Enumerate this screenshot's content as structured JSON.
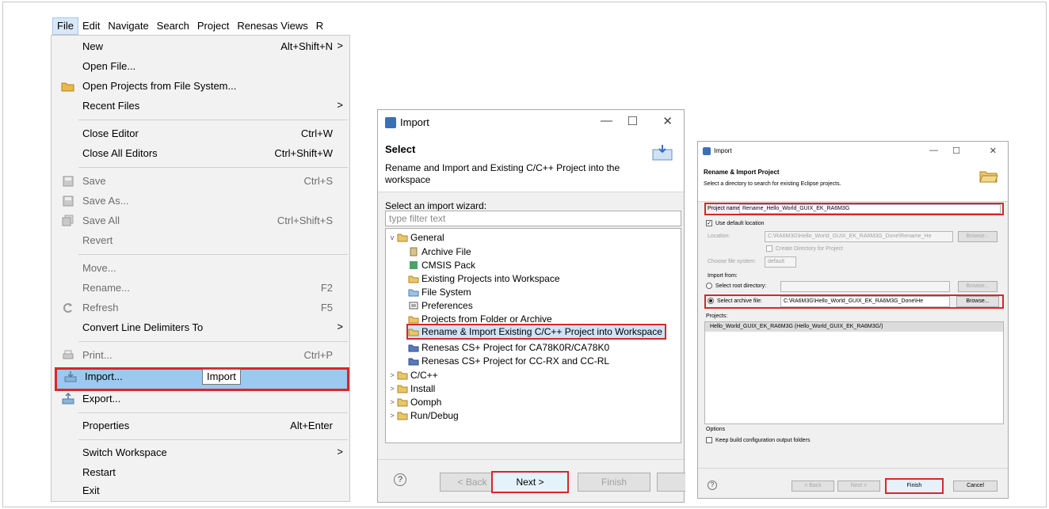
{
  "menubar": {
    "items": [
      "File",
      "Edit",
      "Navigate",
      "Search",
      "Project",
      "Renesas Views",
      "R"
    ]
  },
  "file_menu": {
    "items": [
      {
        "label": "New",
        "accel": "Alt+Shift+N",
        "submenu": true,
        "disabled": false
      },
      {
        "label": "Open File...",
        "accel": "",
        "disabled": false
      },
      {
        "label": "Open Projects from File System...",
        "accel": "",
        "disabled": false,
        "icon": "folder-open-icon"
      },
      {
        "label": "Recent Files",
        "accel": "",
        "submenu": true,
        "disabled": false
      },
      {
        "label": "Close Editor",
        "accel": "Ctrl+W",
        "disabled": false
      },
      {
        "label": "Close All Editors",
        "accel": "Ctrl+Shift+W",
        "disabled": false
      },
      {
        "label": "Save",
        "accel": "Ctrl+S",
        "disabled": true,
        "icon": "save-icon"
      },
      {
        "label": "Save As...",
        "accel": "",
        "disabled": true,
        "icon": "save-as-icon"
      },
      {
        "label": "Save All",
        "accel": "Ctrl+Shift+S",
        "disabled": true,
        "icon": "save-all-icon"
      },
      {
        "label": "Revert",
        "accel": "",
        "disabled": true
      },
      {
        "label": "Move...",
        "accel": "",
        "disabled": true
      },
      {
        "label": "Rename...",
        "accel": "F2",
        "disabled": true
      },
      {
        "label": "Refresh",
        "accel": "F5",
        "disabled": true,
        "icon": "refresh-icon"
      },
      {
        "label": "Convert Line Delimiters To",
        "accel": "",
        "submenu": true,
        "disabled": false
      },
      {
        "label": "Print...",
        "accel": "Ctrl+P",
        "disabled": true,
        "icon": "print-icon"
      },
      {
        "label": "Import...",
        "accel": "",
        "disabled": false,
        "icon": "import-icon",
        "selected": true
      },
      {
        "label": "Export...",
        "accel": "",
        "disabled": false,
        "icon": "export-icon"
      },
      {
        "label": "Properties",
        "accel": "Alt+Enter",
        "disabled": false
      },
      {
        "label": "Switch Workspace",
        "accel": "",
        "submenu": true,
        "disabled": false
      },
      {
        "label": "Restart",
        "accel": "",
        "disabled": false
      },
      {
        "label": "Exit",
        "accel": "",
        "disabled": false
      }
    ],
    "submenu_arrow": ">",
    "tooltip": "Import"
  },
  "import_dialog": {
    "title": "Import",
    "banner_title": "Select",
    "banner_desc": "Rename and Import and Existing C/C++ Project into the workspace",
    "wizard_label": "Select an import wizard:",
    "filter_placeholder": "type filter text",
    "tree": [
      {
        "label": "General",
        "twisty": "v",
        "level": 0,
        "icon": "folder-icon"
      },
      {
        "label": "Archive File",
        "level": 1,
        "icon": "archive-icon"
      },
      {
        "label": "CMSIS Pack",
        "level": 1,
        "icon": "cmsis-icon"
      },
      {
        "label": "Existing Projects into Workspace",
        "level": 1,
        "icon": "project-icon"
      },
      {
        "label": "File System",
        "level": 1,
        "icon": "filesystem-icon"
      },
      {
        "label": "Preferences",
        "level": 1,
        "icon": "preferences-icon"
      },
      {
        "label": "Projects from Folder or Archive",
        "level": 1,
        "icon": "folder-icon"
      },
      {
        "label": "Rename & Import Existing C/C++ Project into Workspace",
        "level": 1,
        "icon": "rename-import-icon",
        "selected": true
      },
      {
        "label": "Renesas CS+ Project for CA78K0R/CA78K0",
        "level": 1,
        "icon": "renesas-icon"
      },
      {
        "label": "Renesas CS+ Project for CC-RX and CC-RL",
        "level": 1,
        "icon": "renesas-icon"
      },
      {
        "label": "C/C++",
        "twisty": ">",
        "level": 0,
        "icon": "folder-icon"
      },
      {
        "label": "Install",
        "twisty": ">",
        "level": 0,
        "icon": "folder-icon"
      },
      {
        "label": "Oomph",
        "twisty": ">",
        "level": 0,
        "icon": "folder-icon"
      },
      {
        "label": "Run/Debug",
        "twisty": ">",
        "level": 0,
        "icon": "folder-icon"
      }
    ],
    "buttons": {
      "back": "< Back",
      "next": "Next >",
      "finish": "Finish"
    },
    "window": {
      "minimize": "—",
      "maximize": "☐",
      "close": "✕"
    }
  },
  "rename_dialog": {
    "title": "Import",
    "banner_title": "Rename & Import Project",
    "banner_desc": "Select a directory to search for existing Eclipse projects.",
    "project_name_label": "Project name:",
    "project_name_value": "Rename_Hello_World_GUIX_EK_RA6M3G",
    "use_default_location": "Use default location",
    "location_label": "Location:",
    "location_value": "C:\\RA6M3G\\Hello_World_GUIX_EK_RA6M3G_Done\\Rename_He",
    "browse": "Browse...",
    "create_directory": "Create Directory for Project",
    "choose_fs_label": "Choose file system:",
    "choose_fs_value": "default",
    "import_from": "Import from:",
    "select_root": "Select root directory:",
    "select_archive": "Select archive file:",
    "archive_value": "C:\\RA6M3G\\Hello_World_GUIX_EK_RA6M3G_Done\\He",
    "projects_label": "Projects:",
    "project_item": "Hello_World_GUIX_EK_RA6M3G (Hello_World_GUIX_EK_RA6M3G/)",
    "options_label": "Options",
    "keep_build": "Keep build configuration output folders",
    "buttons": {
      "back": "< Back",
      "next": "Next >",
      "finish": "Finish",
      "cancel": "Cancel"
    }
  },
  "colors": {
    "highlight_red": "#d9262c",
    "menu_selection": "#9bc9f0",
    "menu_bg": "#f2f2f2"
  }
}
